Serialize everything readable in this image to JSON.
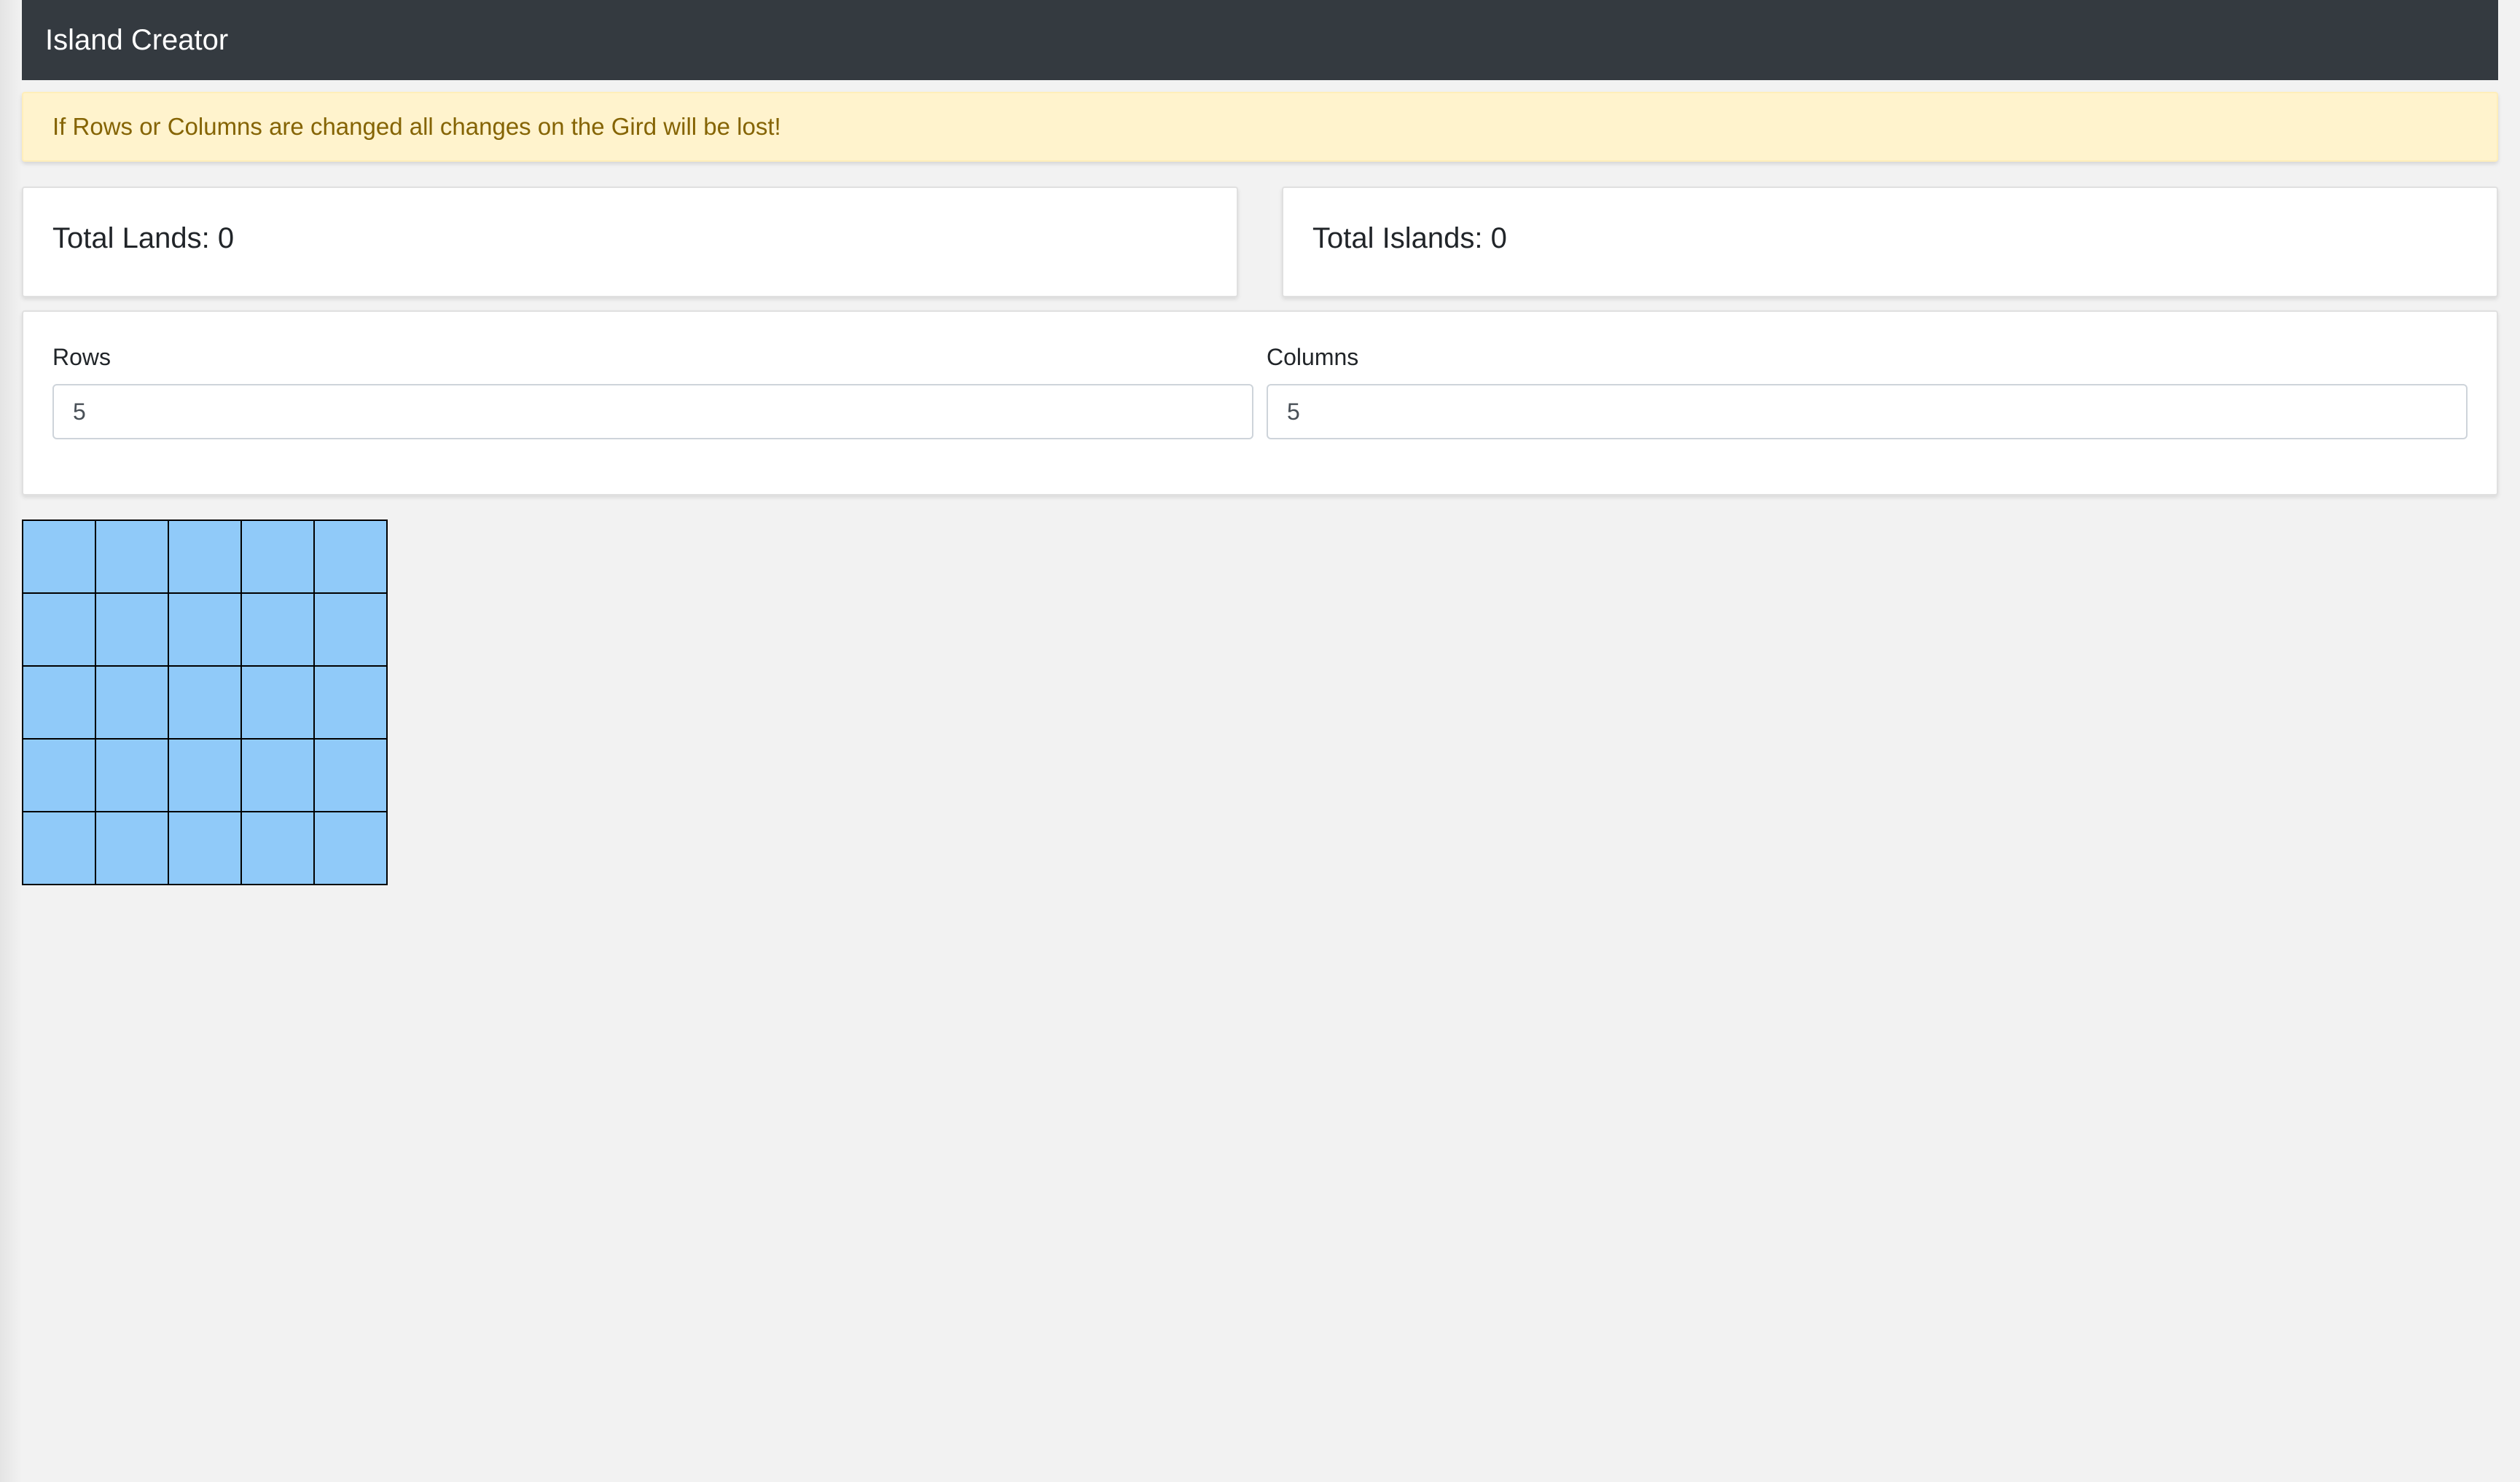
{
  "navbar": {
    "brand": "Island Creator"
  },
  "alert": {
    "message": "If Rows or Columns are changed all changes on the Gird will be lost!"
  },
  "stats": {
    "total_lands_label": "Total Lands: 0",
    "total_islands_label": "Total Islands: 0"
  },
  "form": {
    "rows_label": "Rows",
    "rows_value": "5",
    "columns_label": "Columns",
    "columns_value": "5"
  },
  "grid": {
    "rows": 5,
    "columns": 5,
    "water_color": "#90caf9",
    "border_color": "#000000",
    "cells": [
      [
        "water",
        "water",
        "water",
        "water",
        "water"
      ],
      [
        "water",
        "water",
        "water",
        "water",
        "water"
      ],
      [
        "water",
        "water",
        "water",
        "water",
        "water"
      ],
      [
        "water",
        "water",
        "water",
        "water",
        "water"
      ],
      [
        "water",
        "water",
        "water",
        "water",
        "water"
      ]
    ]
  },
  "colors": {
    "navbar_bg": "#343a40",
    "alert_bg": "#fff3cd",
    "alert_text": "#856404",
    "page_bg": "#f2f2f2"
  }
}
